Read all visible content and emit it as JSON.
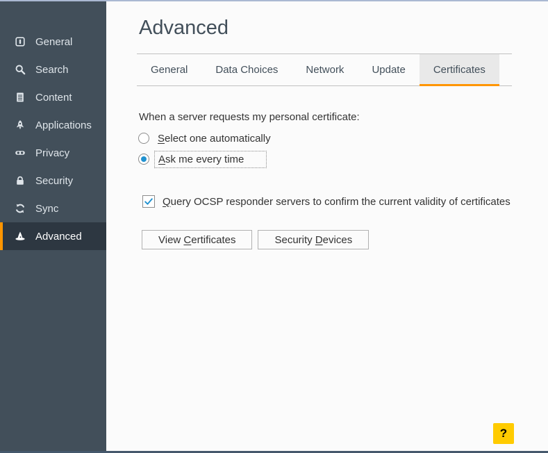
{
  "window": {
    "help_label": "?"
  },
  "sidebar": {
    "items": [
      {
        "label": "General",
        "icon": "general-icon",
        "selected": false
      },
      {
        "label": "Search",
        "icon": "search-icon",
        "selected": false
      },
      {
        "label": "Content",
        "icon": "content-icon",
        "selected": false
      },
      {
        "label": "Applications",
        "icon": "applications-icon",
        "selected": false
      },
      {
        "label": "Privacy",
        "icon": "privacy-icon",
        "selected": false
      },
      {
        "label": "Security",
        "icon": "security-icon",
        "selected": false
      },
      {
        "label": "Sync",
        "icon": "sync-icon",
        "selected": false
      },
      {
        "label": "Advanced",
        "icon": "advanced-icon",
        "selected": true
      }
    ]
  },
  "header": {
    "title": "Advanced"
  },
  "tabs": [
    {
      "label": "General",
      "active": false
    },
    {
      "label": "Data Choices",
      "active": false
    },
    {
      "label": "Network",
      "active": false
    },
    {
      "label": "Update",
      "active": false
    },
    {
      "label": "Certificates",
      "active": true
    }
  ],
  "content": {
    "cert_question": "When a server requests my personal certificate:",
    "radio_options": [
      {
        "text": "Select one automatically",
        "key": "S",
        "selected": false,
        "focused": false
      },
      {
        "text": "Ask me every time",
        "key": "A",
        "selected": true,
        "focused": true
      }
    ],
    "ocsp_checkbox": {
      "text": "Query OCSP responder servers to confirm the current validity of certificates",
      "key": "Q",
      "checked": true
    },
    "buttons": [
      {
        "text": "View Certificates",
        "key": "C"
      },
      {
        "text": "Security Devices",
        "key": "D"
      }
    ]
  },
  "colors": {
    "sidebar_bg": "#424f5a",
    "sidebar_selected_bg": "#2d3741",
    "accent_orange": "#ff9500",
    "content_bg": "#fbfbfb",
    "heading_text": "#424f5a",
    "body_text": "#333333",
    "tab_border": "#c1c1c1",
    "active_tab_bg": "#e9e9e9",
    "radio_blue": "#2292d0",
    "check_blue": "#2292d0",
    "button_border": "#b1b1b1",
    "help_bg": "#ffcb00",
    "help_text": "#000000",
    "window_top_border": "#aab8d2",
    "window_bottom_border": "#45586c"
  }
}
